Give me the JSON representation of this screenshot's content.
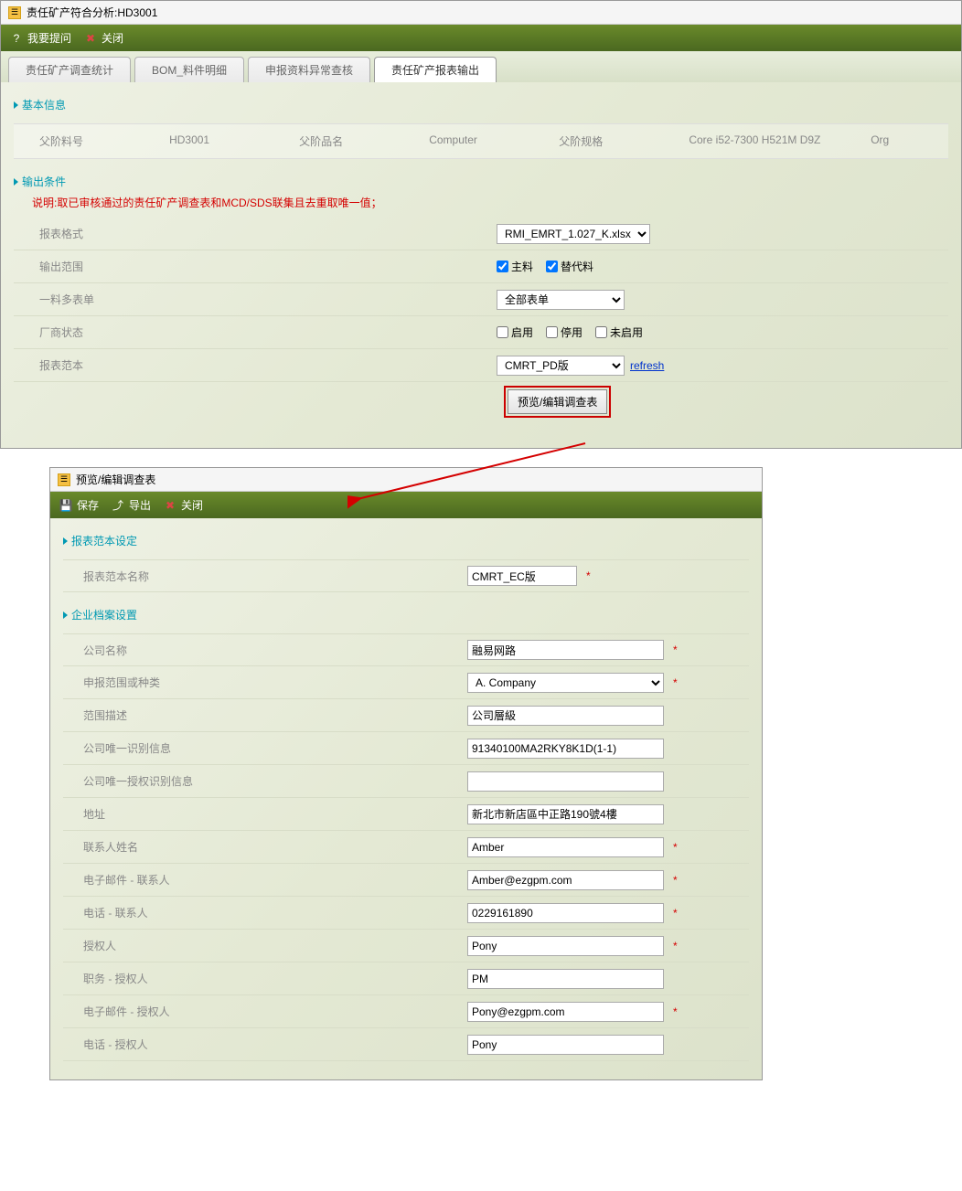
{
  "win1": {
    "title": "责任矿产符合分析:HD3001",
    "toolbar": {
      "ask": "我要提问",
      "close": "关闭"
    },
    "tabs": [
      "责任矿产调查统计",
      "BOM_料件明细",
      "申报资料异常查核",
      "责任矿产报表输出"
    ],
    "sect_basic": "基本信息",
    "info": {
      "l1": "父阶料号",
      "v1": "HD3001",
      "l2": "父阶品名",
      "v2": "Computer",
      "l3": "父阶规格",
      "v3": "Core i52-7300 H521M D9Z",
      "l4": "Org"
    },
    "sect_out": "输出条件",
    "note": "说明:取已审核通过的责任矿产调查表和MCD/SDS联集且去重取唯一值；",
    "rows": {
      "fmt_l": "报表格式",
      "fmt_v": "RMI_EMRT_1.027_K.xlsx",
      "scope_l": "输出范围",
      "chk1": "主料",
      "chk2": "替代料",
      "multi_l": "一料多表单",
      "multi_v": "全部表单",
      "vendor_l": "厂商状态",
      "vc1": "启用",
      "vc2": "停用",
      "vc3": "未启用",
      "tmpl_l": "报表范本",
      "tmpl_v": "CMRT_PD版",
      "refresh": "refresh"
    },
    "btn": "预览/编辑调查表"
  },
  "win2": {
    "title": "预览/编辑调查表",
    "toolbar": {
      "save": "保存",
      "export": "导出",
      "close": "关闭"
    },
    "sect_tmpl": "报表范本设定",
    "tmpl_name_l": "报表范本名称",
    "tmpl_name_v": "CMRT_EC版",
    "sect_ent": "企业档案设置",
    "f": {
      "company_l": "公司名称",
      "company_v": "融易网路",
      "decl_l": "申报范围或种类",
      "decl_v": "A. Company",
      "range_l": "范围描述",
      "range_v": "公司層級",
      "uid_l": "公司唯一识别信息",
      "uid_v": "91340100MA2RKY8K1D(1-1)",
      "auth_l": "公司唯一授权识别信息",
      "auth_v": "",
      "addr_l": "地址",
      "addr_v": "新北市新店區中正路190號4樓",
      "cname_l": "联系人姓名",
      "cname_v": "Amber",
      "cemail_l": "电子邮件 - 联系人",
      "cemail_v": "Amber@ezgpm.com",
      "cphone_l": "电话 - 联系人",
      "cphone_v": "0229161890",
      "ap_l": "授权人",
      "ap_v": "Pony",
      "apjob_l": "职务 - 授权人",
      "apjob_v": "PM",
      "apemail_l": "电子邮件 - 授权人",
      "apemail_v": "Pony@ezgpm.com",
      "apphone_l": "电话 - 授权人",
      "apphone_v": "Pony"
    }
  }
}
